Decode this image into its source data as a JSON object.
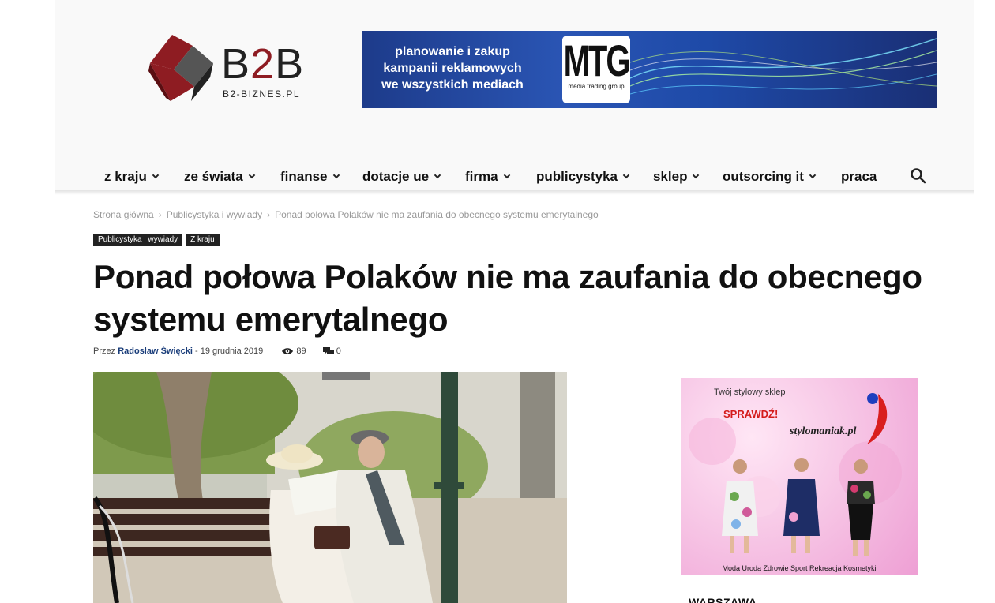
{
  "logo": {
    "text_a": "B",
    "text_2": "2",
    "text_b": "B",
    "subtitle": "B2-BIZNES.PL"
  },
  "banner": {
    "line1": "planowanie i zakup",
    "line2": "kampanii reklamowych",
    "line3": "we wszystkich mediach",
    "brand": "MTG",
    "brand_sub": "media trading group"
  },
  "nav": {
    "items": [
      {
        "label": "z kraju",
        "has_dropdown": true
      },
      {
        "label": "ze świata",
        "has_dropdown": true
      },
      {
        "label": "finanse",
        "has_dropdown": true
      },
      {
        "label": "dotacje ue",
        "has_dropdown": true
      },
      {
        "label": "firma",
        "has_dropdown": true
      },
      {
        "label": "publicystyka",
        "has_dropdown": true
      },
      {
        "label": "sklep",
        "has_dropdown": true
      },
      {
        "label": "outsorcing it",
        "has_dropdown": true
      },
      {
        "label": "praca",
        "has_dropdown": false
      }
    ],
    "search_icon": "search-icon"
  },
  "breadcrumb": {
    "home": "Strona główna",
    "section": "Publicystyka i wywiady",
    "current": "Ponad połowa Polaków nie ma zaufania do obecnego systemu emerytalnego",
    "separator": "›"
  },
  "tags": [
    "Publicystyka i wywiady",
    "Z kraju"
  ],
  "article": {
    "title": "Ponad połowa Polaków nie ma zaufania do obecnego systemu emerytalnego",
    "by_label": "Przez",
    "author": "Radosław Święcki",
    "dash": "-",
    "date": "19 grudnia 2019",
    "views": "89",
    "comments": "0"
  },
  "side_ad": {
    "line1": "Twój stylowy sklep",
    "line2": "SPRAWDŹ!",
    "line3": "stylomaniak.pl",
    "footer": "Moda Uroda Zdrowie Sport Rekreacja Kosmetyki"
  },
  "sidebar": {
    "heading": "WARSZAWA"
  },
  "colors": {
    "brand_red": "#8e1c22",
    "author_blue": "#1a3d7a",
    "tag_bg": "#222222"
  }
}
